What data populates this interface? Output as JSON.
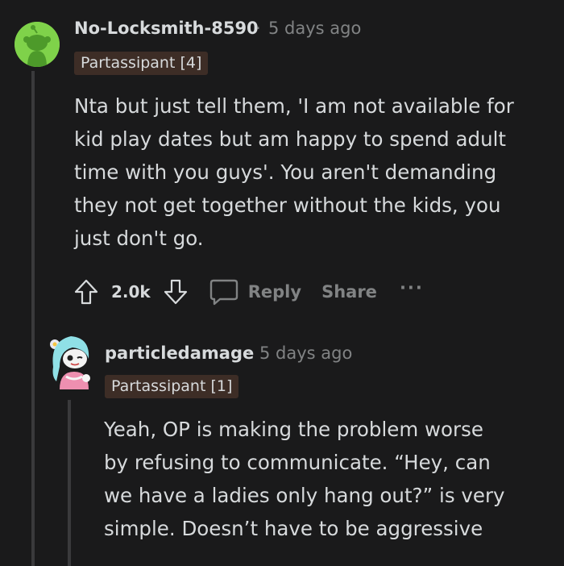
{
  "comment": {
    "author": "No-Locksmith-8590",
    "separator": "·",
    "time": "5 days ago",
    "flair": "Partassipant [4]",
    "body": "Nta but just tell them, 'I am not available for\nkid play dates but am happy to spend adult\ntime with you guys'. You aren't demanding\nthey not get together without the kids, you\njust don't go.",
    "score": "2.0k",
    "reply_label": "Reply",
    "share_label": "Share",
    "more_label": "···"
  },
  "reply": {
    "author": "particledamage",
    "separator": "·",
    "time": "5 days ago",
    "flair": "Partassipant [1]",
    "body": "Yeah, OP is making the problem worse\nby refusing to communicate. “Hey, can\nwe have a ladies only hang out?” is very\nsimple. Doesn’t have to be aggressive"
  },
  "colors": {
    "background": "#1a1a1b",
    "text": "#d7dadc",
    "meta": "#818384",
    "flair_bg": "#3d2d26",
    "avatar_green": "#7fd24a",
    "thread_line": "#3a3a3c"
  }
}
